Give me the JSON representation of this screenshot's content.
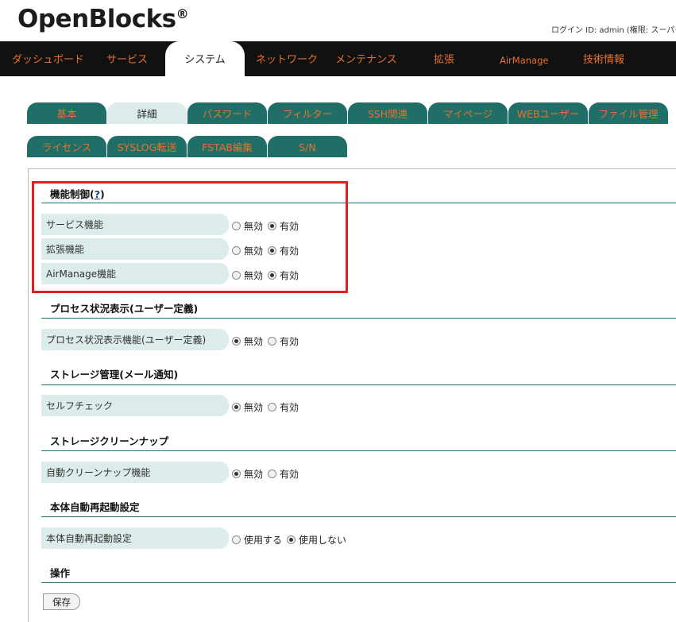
{
  "brand": {
    "logo": "OpenBlocks",
    "mark": "®"
  },
  "login_info": "ログイン ID: admin (権限: スーパー",
  "main_nav": [
    {
      "label": "ダッシュボード"
    },
    {
      "label": "サービス"
    },
    {
      "label": "システム",
      "active": true
    },
    {
      "label": "ネットワーク"
    },
    {
      "label": "メンテナンス"
    },
    {
      "label": "拡張"
    },
    {
      "label": "AirManage"
    },
    {
      "label": "技術情報"
    }
  ],
  "sub_tabs": [
    {
      "label": "基本"
    },
    {
      "label": "詳細",
      "active": true
    },
    {
      "label": "パスワード"
    },
    {
      "label": "フィルター"
    },
    {
      "label": "SSH関連"
    },
    {
      "label": "マイページ"
    },
    {
      "label": "WEBユーザー"
    },
    {
      "label": "ファイル管理"
    },
    {
      "label": "ライセンス"
    },
    {
      "label": "SYSLOG転送"
    },
    {
      "label": "FSTAB編集"
    },
    {
      "label": "S/N"
    }
  ],
  "sections": [
    {
      "title": "機能制御",
      "help": "?",
      "rows": [
        {
          "label": "サービス機能",
          "options": [
            "無効",
            "有効"
          ],
          "selected": "有効"
        },
        {
          "label": "拡張機能",
          "options": [
            "無効",
            "有効"
          ],
          "selected": "有効"
        },
        {
          "label": "AirManage機能",
          "options": [
            "無効",
            "有効"
          ],
          "selected": "有効"
        }
      ]
    },
    {
      "title": "プロセス状況表示(ユーザー定義)",
      "rows": [
        {
          "label": "プロセス状況表示機能(ユーザー定義)",
          "options": [
            "無効",
            "有効"
          ],
          "selected": "無効"
        }
      ]
    },
    {
      "title": "ストレージ管理(メール通知)",
      "rows": [
        {
          "label": "セルフチェック",
          "options": [
            "無効",
            "有効"
          ],
          "selected": "無効"
        }
      ]
    },
    {
      "title": "ストレージクリーンナップ",
      "rows": [
        {
          "label": "自動クリーンナップ機能",
          "options": [
            "無効",
            "有効"
          ],
          "selected": "無効"
        }
      ]
    },
    {
      "title": "本体自動再起動設定",
      "rows": [
        {
          "label": "本体自動再起動設定",
          "options": [
            "使用する",
            "使用しない"
          ],
          "selected": "使用しない"
        }
      ]
    },
    {
      "title": "操作",
      "rows": []
    }
  ],
  "save_label": "保存",
  "colors": {
    "nav_bg": "#111111",
    "accent_orange": "#e8722a",
    "tab_teal": "#1f6e68",
    "row_bg": "#dcecea",
    "highlight_red": "#e02020"
  }
}
